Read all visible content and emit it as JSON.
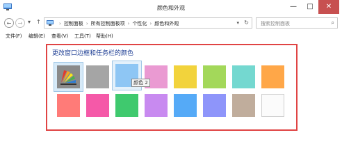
{
  "window": {
    "title": "颜色和外观",
    "minimize_glyph": "—",
    "maximize_glyph": "□",
    "close_glyph": "✕"
  },
  "address_bar": {
    "back_glyph": "←",
    "forward_glyph": "→",
    "recent_glyph": "▾",
    "up_glyph": "↑",
    "breadcrumbs": [
      "控制面板",
      "所有控制面板项",
      "个性化",
      "颜色和外观"
    ],
    "separator": "›",
    "dropdown_glyph": "▾",
    "refresh_glyph": "↻",
    "search_placeholder": "搜索控制面板",
    "search_glyph": "⌕"
  },
  "menu": {
    "items": [
      "文件(F)",
      "编辑(E)",
      "查看(V)",
      "工具(T)",
      "帮助(H)"
    ]
  },
  "content": {
    "heading": "更改窗口边框和任务栏的颜色",
    "tooltip": "颜色 2"
  },
  "colors": {
    "row1": [
      "#8a8a8a",
      "#a5a5a5",
      "#8ec6f4",
      "#ea9ad2",
      "#f2d33c",
      "#a3d85a",
      "#74d8d0",
      "#ffa748"
    ],
    "row2": [
      "#ff7b78",
      "#f559a8",
      "#3fc96e",
      "#c88af0",
      "#55aaf7",
      "#8e95fa",
      "#c0ad9c",
      "#fbfbfb"
    ],
    "accent_border": "#e04444",
    "heading_color": "#1e3e94"
  }
}
